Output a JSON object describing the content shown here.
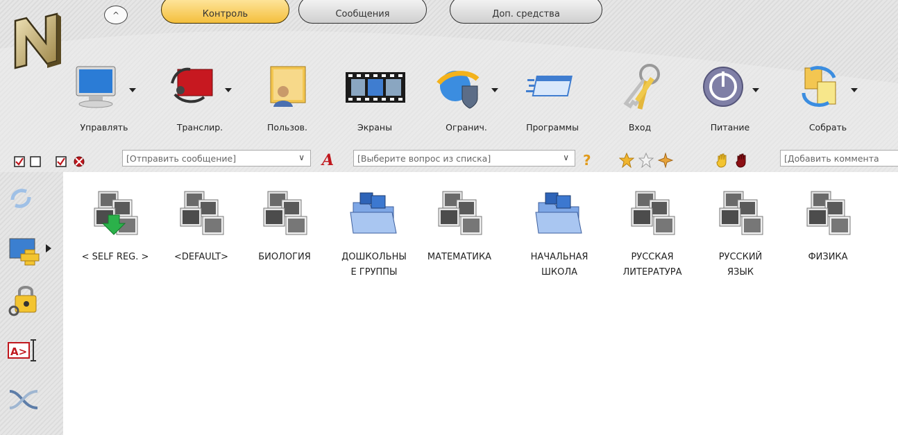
{
  "tabs": [
    {
      "label": "Контроль",
      "active": true
    },
    {
      "label": "Сообщения",
      "active": false
    },
    {
      "label": "Доп. средства",
      "active": false
    }
  ],
  "up_button_symbol": "^",
  "tools": [
    {
      "label": "Управлять",
      "icon": "monitor-icon",
      "dropdown": true
    },
    {
      "label": "Транслир.",
      "icon": "broadcast-icon",
      "dropdown": true
    },
    {
      "label": "Пользов.",
      "icon": "user-screen-icon",
      "dropdown": false
    },
    {
      "label": "Экраны",
      "icon": "filmstrip-icon",
      "dropdown": false
    },
    {
      "label": "Огранич.",
      "icon": "browser-shield-icon",
      "dropdown": true
    },
    {
      "label": "Программы",
      "icon": "program-window-icon",
      "dropdown": false
    },
    {
      "label": "Вход",
      "icon": "keys-icon",
      "dropdown": false
    },
    {
      "label": "Питание",
      "icon": "power-icon",
      "dropdown": true
    },
    {
      "label": "Собрать",
      "icon": "collect-files-icon",
      "dropdown": true
    }
  ],
  "message_bar": {
    "message_placeholder": "[Отправить сообщение]",
    "question_placeholder": "[Выберите вопрос из списка]",
    "comment_placeholder": "[Добавить коммента"
  },
  "groups": [
    {
      "label": "< SELF REG. >",
      "icon": "computers-download-icon"
    },
    {
      "label": "<DEFAULT>",
      "icon": "computers-icon"
    },
    {
      "label": "БИОЛОГИЯ",
      "icon": "computers-icon"
    },
    {
      "label": "ДОШКОЛЬНЫ Е ГРУППЫ",
      "icon": "folder-computers-icon"
    },
    {
      "label": "МАТЕМАТИКА",
      "icon": "computers-icon"
    },
    {
      "label": "НАЧАЛЬНАЯ ШКОЛА",
      "icon": "folder-computers-icon"
    },
    {
      "label": "РУССКАЯ ЛИТЕРАТУРА",
      "icon": "computers-icon"
    },
    {
      "label": "РУССКИЙ ЯЗЫК",
      "icon": "computers-icon"
    },
    {
      "label": "ФИЗИКА",
      "icon": "computers-icon"
    }
  ],
  "group_lines": [
    [
      "< SELF REG. >"
    ],
    [
      "<DEFAULT>"
    ],
    [
      "БИОЛОГИЯ"
    ],
    [
      "ДОШКОЛЬНЫ",
      "Е ГРУППЫ"
    ],
    [
      "МАТЕМАТИКА"
    ],
    [
      "НАЧАЛЬНАЯ",
      "ШКОЛА"
    ],
    [
      "РУССКАЯ",
      "ЛИТЕРАТУРА"
    ],
    [
      "РУССКИЙ",
      "ЯЗЫК"
    ],
    [
      "ФИЗИКА"
    ]
  ],
  "colors": {
    "active_tab": "#f4bf3d",
    "accent_red": "#c0171d",
    "ribbon_bg": "#e2e2e2"
  }
}
